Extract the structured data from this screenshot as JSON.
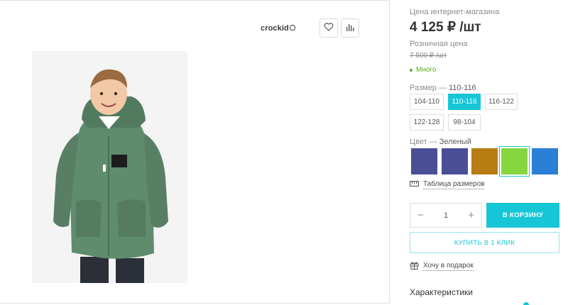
{
  "brand": {
    "name": "crockid"
  },
  "product": {
    "price_label": "Цена интернет-магазина",
    "price": "4 125 ₽ /шт",
    "retail_label": "Розничная цена",
    "retail_price": "7 500 ₽ /шт",
    "stock": "Много"
  },
  "size": {
    "label": "Размер",
    "separator": "—",
    "selected": "110-116",
    "options": [
      "104-110",
      "110-116",
      "116-122",
      "122-128",
      "98-104"
    ],
    "active_index": 1
  },
  "color": {
    "label": "Цвет",
    "separator": "—",
    "selected": "Зеленый",
    "swatches": [
      "#4a4f95",
      "#4a4f95",
      "#b77c12",
      "#86d63f",
      "#2a7fd6"
    ],
    "active_index": 3
  },
  "links": {
    "size_table": "Таблица размеров",
    "gift": "Хочу в подарок"
  },
  "cart": {
    "quantity": "1",
    "minus": "−",
    "plus": "+",
    "add_label": "В КОРЗИНУ",
    "one_click_label": "КУПИТЬ В 1 КЛИК"
  },
  "sections": {
    "specs_title": "Характеристики"
  },
  "icons": {
    "favorite": "heart-icon",
    "compare": "bar-chart-icon",
    "ruler": "ruler-icon",
    "gift": "gift-icon"
  },
  "colors": {
    "accent": "#17c6d6",
    "in_stock": "#5aa92a"
  }
}
